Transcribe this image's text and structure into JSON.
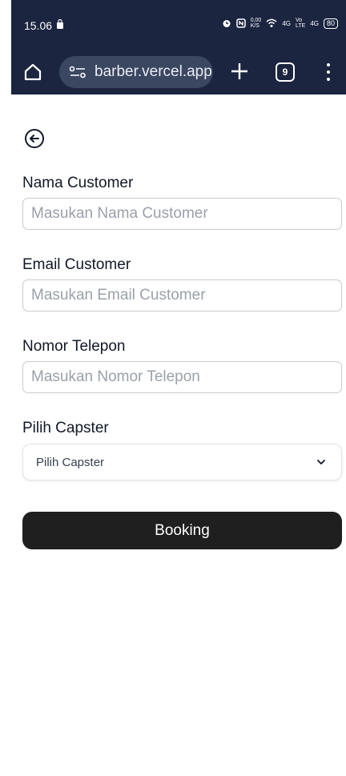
{
  "status_bar": {
    "time": "15.06",
    "net_speed": "0,00\nK/S",
    "signal1": "4G",
    "volte": "Vo\nLTE",
    "signal2": "4G",
    "battery": "80"
  },
  "browser": {
    "url": "barber.vercel.app",
    "tab_count": "9"
  },
  "form": {
    "name_label": "Nama Customer",
    "name_placeholder": "Masukan Nama Customer",
    "email_label": "Email Customer",
    "email_placeholder": "Masukan Email Customer",
    "phone_label": "Nomor Telepon",
    "phone_placeholder": "Masukan Nomor Telepon",
    "capster_label": "Pilih Capster",
    "capster_selected": "Pilih Capster",
    "submit_label": "Booking"
  },
  "colors": {
    "header_bg": "#1b2540",
    "button_bg": "#1f1f1f"
  }
}
